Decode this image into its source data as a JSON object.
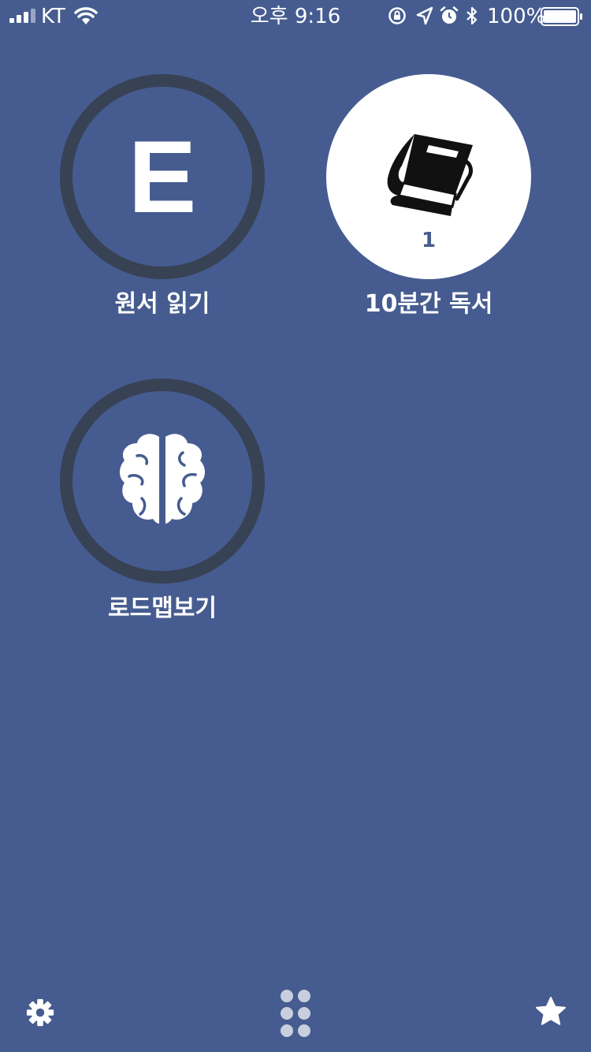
{
  "status_bar": {
    "carrier": "KT",
    "time": "오후 9:16",
    "battery_percent": "100%",
    "battery_level": 1.0,
    "icons": [
      "signal-icon",
      "wifi-icon",
      "orientation-lock-icon",
      "location-icon",
      "alarm-icon",
      "bluetooth-icon",
      "battery-icon"
    ]
  },
  "tiles": [
    {
      "icon": "letter-e-icon",
      "letter": "E",
      "label": "원서 읽기",
      "style": "ring"
    },
    {
      "icon": "book-icon",
      "count": "1",
      "label": "10분간 독서",
      "style": "filled"
    },
    {
      "icon": "brain-icon",
      "label": "로드맵보기",
      "style": "ring"
    }
  ],
  "bottom_bar": {
    "icons": [
      "settings-gear-icon",
      "menu-grid-icon",
      "favorites-star-icon"
    ]
  },
  "colors": {
    "background": "#465c90",
    "ring": "#384255",
    "filled_circle": "#ffffff",
    "text": "#ffffff"
  }
}
